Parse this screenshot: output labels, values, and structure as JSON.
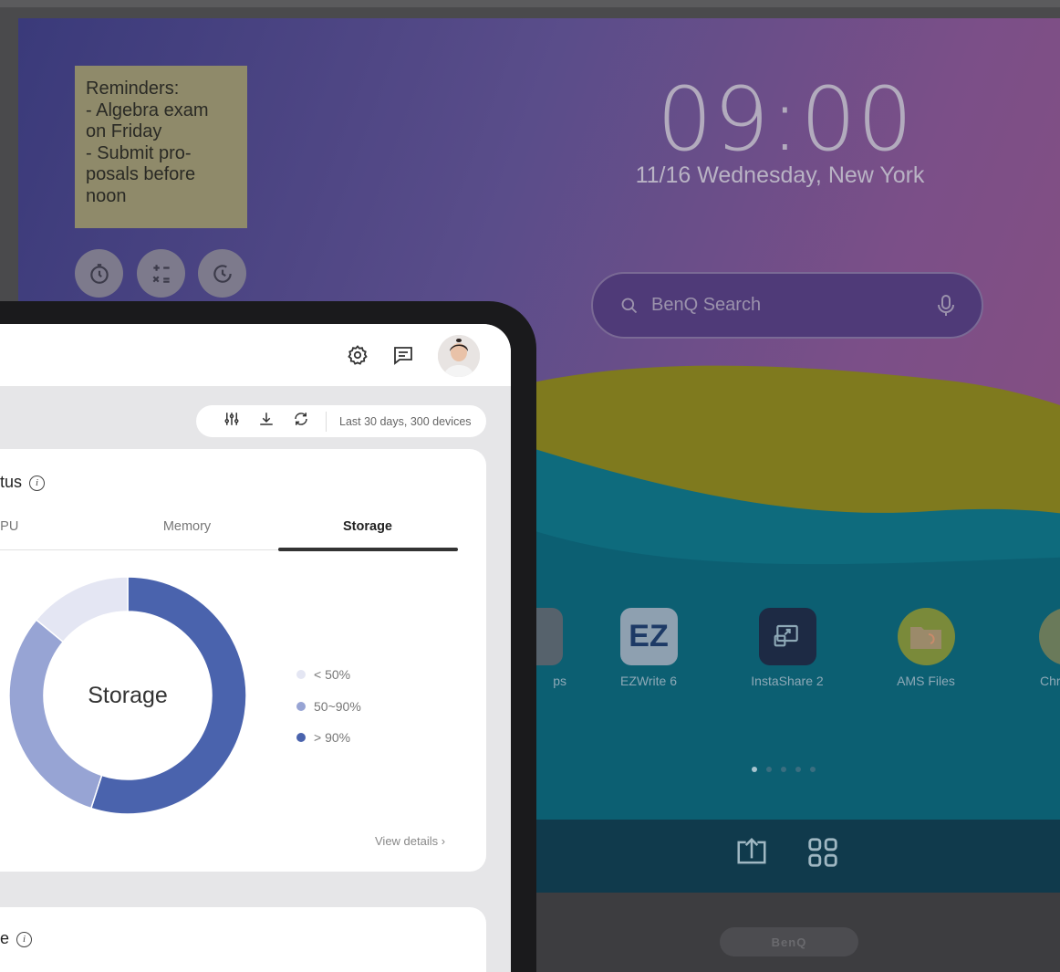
{
  "display": {
    "note_lines": [
      "Reminders:",
      "- Algebra exam",
      "on Friday",
      "- Submit pro-",
      "posals before",
      "noon"
    ],
    "tools": [
      {
        "name": "timer-icon",
        "glyph": "⏱"
      },
      {
        "name": "calculator-icon",
        "glyph": "±"
      },
      {
        "name": "stopwatch-icon",
        "glyph": "⟳"
      }
    ],
    "clock": "09:00",
    "date": "11/16 Wednesday, New York",
    "search_placeholder": "BenQ Search",
    "apps": [
      {
        "label": "ps",
        "color": "#56626c"
      },
      {
        "label": "EZWrite 6",
        "color": "#8ea0b0"
      },
      {
        "label": "InstaShare 2",
        "color": "#1d2a44"
      },
      {
        "label": "AMS Files",
        "color": "#7a8a3a"
      },
      {
        "label": "Chr",
        "color": "#6a7a5a"
      }
    ],
    "brand": "BenQ"
  },
  "tablet": {
    "filter_range": "Last 30 days, 300 devices",
    "card1": {
      "title": "atus",
      "tabs": [
        "CPU",
        "Memory",
        "Storage"
      ],
      "active_tab": "Storage",
      "view_details": "View details"
    },
    "card2": {
      "title": "ge"
    }
  },
  "chart_data": {
    "type": "pie",
    "title": "Storage",
    "categories": [
      "< 50%",
      "50~90%",
      "> 90%"
    ],
    "values": [
      14,
      31,
      55
    ],
    "colors": [
      "#e4e6f3",
      "#97a4d4",
      "#4a63ad"
    ]
  }
}
